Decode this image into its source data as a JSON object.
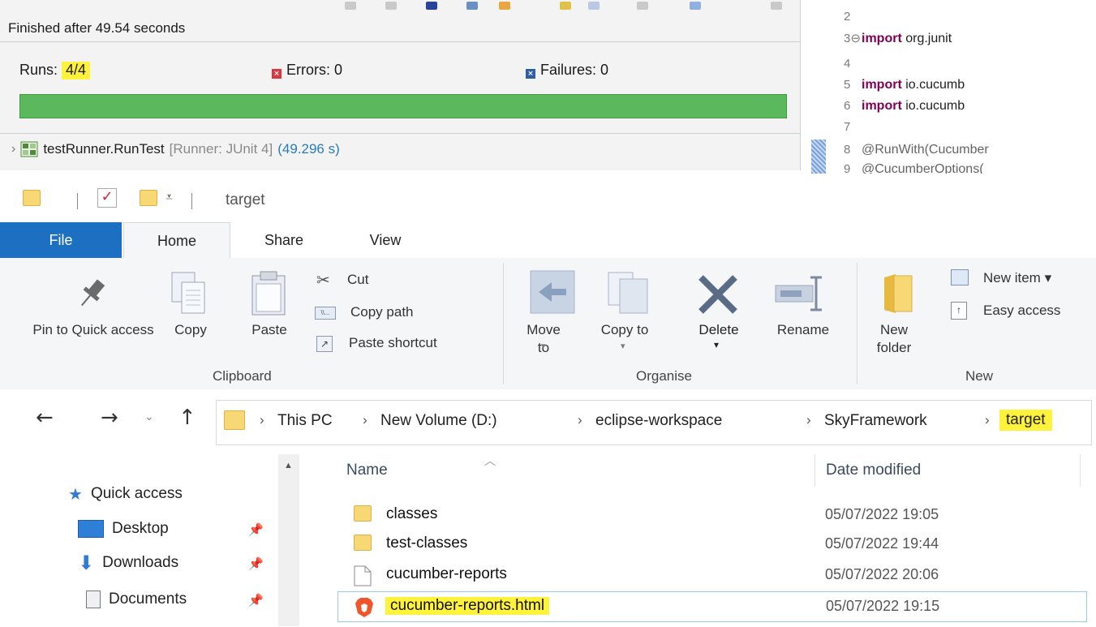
{
  "junit": {
    "finished": "Finished after 49.54 seconds",
    "runs_label": "Runs:",
    "runs_value": "4/4",
    "errors": "Errors:  0",
    "failures": "Failures:  0",
    "progress_fraction": 1.0,
    "progress_color": "#5bb85d",
    "runner_name": "testRunner.RunTest",
    "runner_meta": "[Runner: JUnit 4]",
    "runner_time": "(49.296 s)"
  },
  "editor": {
    "lines": [
      {
        "num": "2",
        "text": ""
      },
      {
        "num": "3⊖",
        "kw": "import",
        "text": " org.junit"
      },
      {
        "num": "4",
        "text": ""
      },
      {
        "num": "5",
        "kw": "import",
        "text": " io.cucumb"
      },
      {
        "num": "6",
        "kw": "import",
        "text": " io.cucumb"
      },
      {
        "num": "7",
        "text": ""
      },
      {
        "num": "8",
        "text": "@RunWith(Cucumber"
      },
      {
        "num": "9",
        "text": "@CucumberOptions("
      }
    ]
  },
  "explorer": {
    "title": "target",
    "tabs": [
      "File",
      "Home",
      "Share",
      "View"
    ],
    "ribbon": {
      "pin_label": "Pin to Quick access",
      "copy": "Copy",
      "paste": "Paste",
      "cut": "Cut",
      "copy_path": "Copy path",
      "paste_shortcut": "Paste shortcut",
      "move_to": "Move to",
      "copy_to": "Copy to",
      "delete": "Delete",
      "rename": "Rename",
      "new_folder": "New folder",
      "new_item": "New item",
      "easy_access": "Easy access",
      "groups": {
        "clipboard": "Clipboard",
        "organise": "Organise",
        "new": "New"
      }
    },
    "breadcrumb": [
      "This PC",
      "New Volume (D:)",
      "eclipse-workspace",
      "SkyFramework",
      "target"
    ],
    "nav_pane": [
      {
        "label": "Quick access",
        "icon": "star-icon"
      },
      {
        "label": "Desktop",
        "icon": "desktop-icon"
      },
      {
        "label": "Downloads",
        "icon": "download-icon"
      },
      {
        "label": "Documents",
        "icon": "documents-icon"
      }
    ],
    "columns": {
      "name": "Name",
      "date": "Date modified"
    },
    "files": [
      {
        "name": "classes",
        "date": "05/07/2022 19:05",
        "icon": "folder-icon"
      },
      {
        "name": "test-classes",
        "date": "05/07/2022 19:44",
        "icon": "folder-icon"
      },
      {
        "name": "cucumber-reports",
        "date": "05/07/2022 20:06",
        "icon": "file-icon"
      },
      {
        "name": "cucumber-reports.html",
        "date": "05/07/2022 19:15",
        "icon": "brave-browser-icon"
      }
    ]
  },
  "colors": {
    "highlight": "#fff23a",
    "accent_blue": "#1d6fc2",
    "error_red": "#d9363e",
    "failure_blue": "#2f5f9e"
  }
}
